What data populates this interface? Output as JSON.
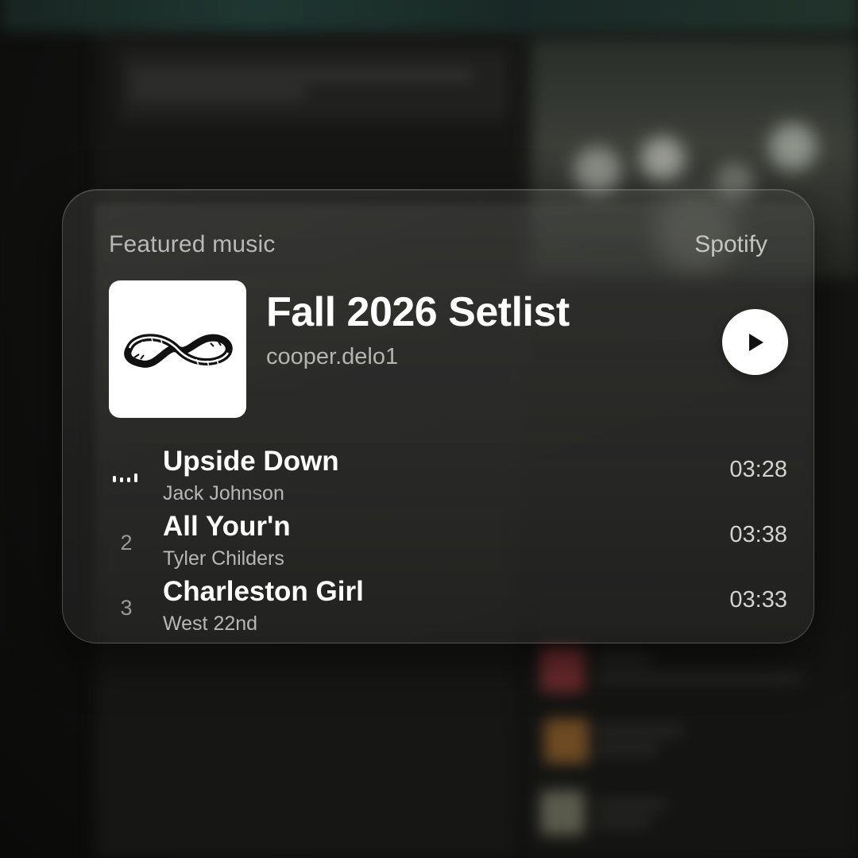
{
  "widget": {
    "section_label": "Featured music",
    "source_label": "Spotify",
    "cover_icon": "rubber-band-logo",
    "playlist_title": "Fall 2026 Setlist",
    "playlist_owner": "cooper.delo1",
    "play_icon": "play-icon"
  },
  "tracks": [
    {
      "index": "",
      "playing": true,
      "title": "Upside Down",
      "artist": "Jack Johnson",
      "duration": "03:28"
    },
    {
      "index": "2",
      "playing": false,
      "title": "All Your'n",
      "artist": "Tyler Childers",
      "duration": "03:38"
    },
    {
      "index": "3",
      "playing": false,
      "title": "Charleston Girl",
      "artist": "West 22nd",
      "duration": "03:33"
    }
  ],
  "colors": {
    "card_text": "#ffffff",
    "muted_text": "#b7b7b4",
    "play_button_bg": "#ffffff"
  }
}
